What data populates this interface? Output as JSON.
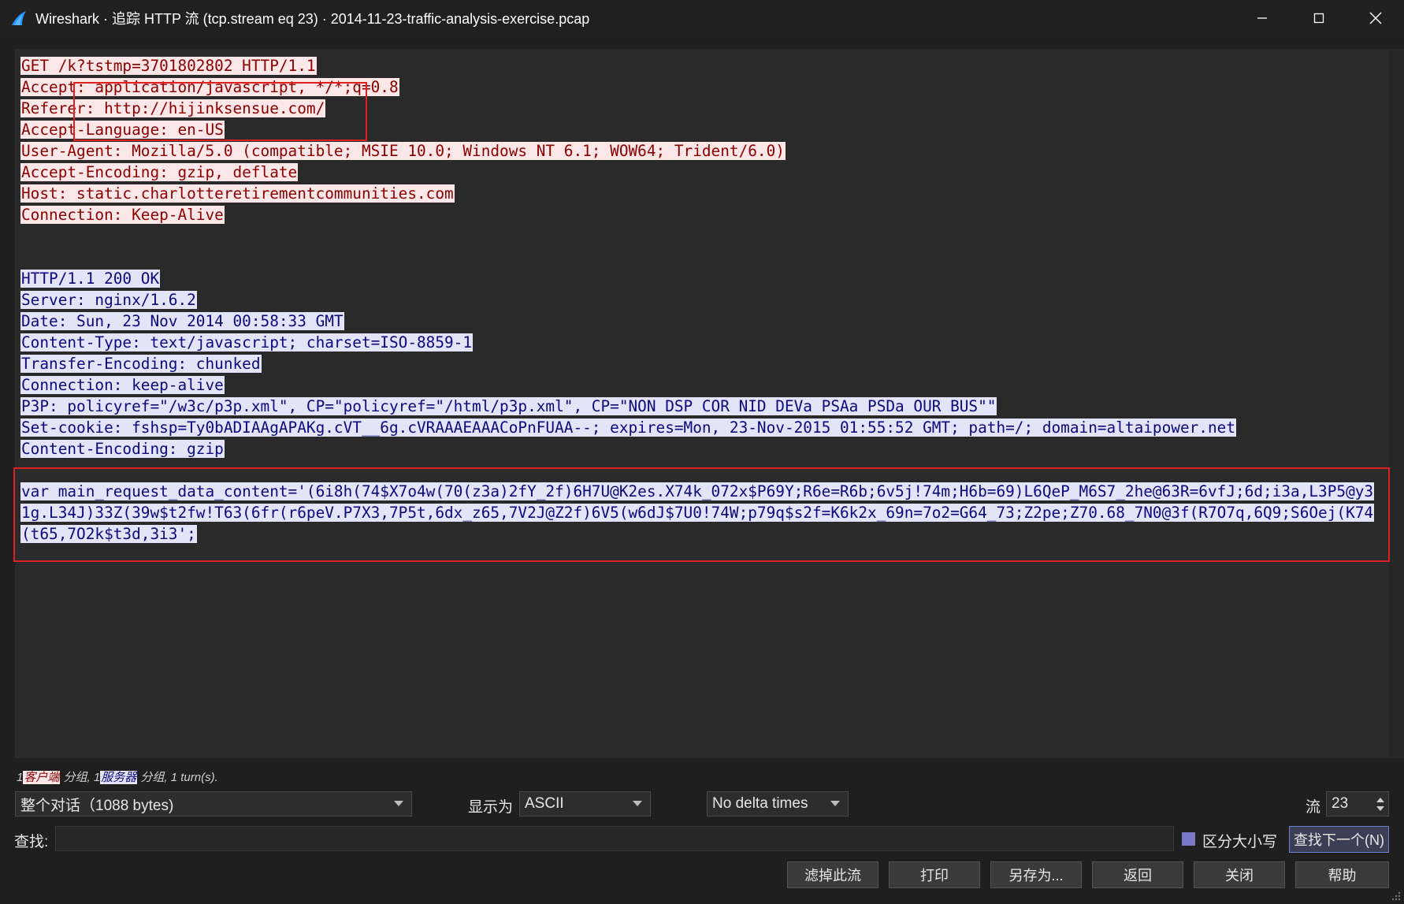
{
  "window": {
    "title": "Wireshark · 追踪 HTTP 流 (tcp.stream eq 23) · 2014-11-23-traffic-analysis-exercise.pcap",
    "accent_color": "#1e90ff"
  },
  "stream": {
    "client_color": "#8a0000",
    "client_bg": "#fbe7e7",
    "server_color": "#0a0a7a",
    "server_bg": "#e4e4f9",
    "request_lines": [
      "GET /k?tstmp=3701802802 HTTP/1.1",
      "Accept: application/javascript, */*;q=0.8",
      "Referer: http://hijinksensue.com/",
      "Accept-Language: en-US",
      "User-Agent: Mozilla/5.0 (compatible; MSIE 10.0; Windows NT 6.1; WOW64; Trident/6.0)",
      "Accept-Encoding: gzip, deflate",
      "Host: static.charlotteretirementcommunities.com",
      "Connection: Keep-Alive"
    ],
    "response_lines": [
      "HTTP/1.1 200 OK",
      "Server: nginx/1.6.2",
      "Date: Sun, 23 Nov 2014 00:58:33 GMT",
      "Content-Type: text/javascript; charset=ISO-8859-1",
      "Transfer-Encoding: chunked",
      "Connection: keep-alive",
      "P3P: policyref=\"/w3c/p3p.xml\", CP=\"policyref=\"/html/p3p.xml\", CP=\"NON DSP COR NID DEVa PSAa PSDa OUR BUS\"\"",
      "Set-cookie: fshsp=Ty0bADIAAgAPAKg.cVT__6g.cVRAAAEAAACoPnFUAA--; expires=Mon, 23-Nov-2015 01:55:52 GMT; path=/; domain=altaipower.net",
      "Content-Encoding: gzip"
    ],
    "body_lines": [
      "var main_request_data_content='(6i8h(74$X7o4w(70(z3a)2fY_2f)6H7U@K2es.X74k_072x$P69Y;R6e=R6b;6v5j!74m;H6b=69)L6QeP_M6S7_2he@63R=6vfJ;6d;i3a,L3P5@y3",
      "1g.L34J)33Z(39w$t2fw!T63(6fr(r6peV.P7X3,7P5t,6dx_z65,7V2J@Z2f)6V5(w6dJ$7U0!74W;p79q$s2f=K6k2x_69n=7o2=G64_73;Z2pe;Z70.68_7N0@3f(R7O7q,6Q9;S6Oej(K74",
      "(t65,7O2k$t3d,3i3';"
    ]
  },
  "summary": {
    "client_count": "1",
    "client_tag": "客户端",
    "client_suffix": "分组,",
    "server_count": "1",
    "server_tag": "服务器",
    "server_suffix": "分组,",
    "turns": "1 turn(s)."
  },
  "controls": {
    "conversation_select": "整个对话（1088 bytes)",
    "show_as_label": "显示为",
    "show_as_select": "ASCII",
    "delta_select": "No delta times",
    "stream_label": "流",
    "stream_value": "23",
    "find_label": "查找:",
    "find_value": "",
    "case_label": "区分大小写",
    "find_next_button": "查找下一个(N)"
  },
  "buttons": {
    "filter_out": "滤掉此流",
    "print": "打印",
    "save_as": "另存为...",
    "back": "返回",
    "close": "关闭",
    "help": "帮助"
  }
}
